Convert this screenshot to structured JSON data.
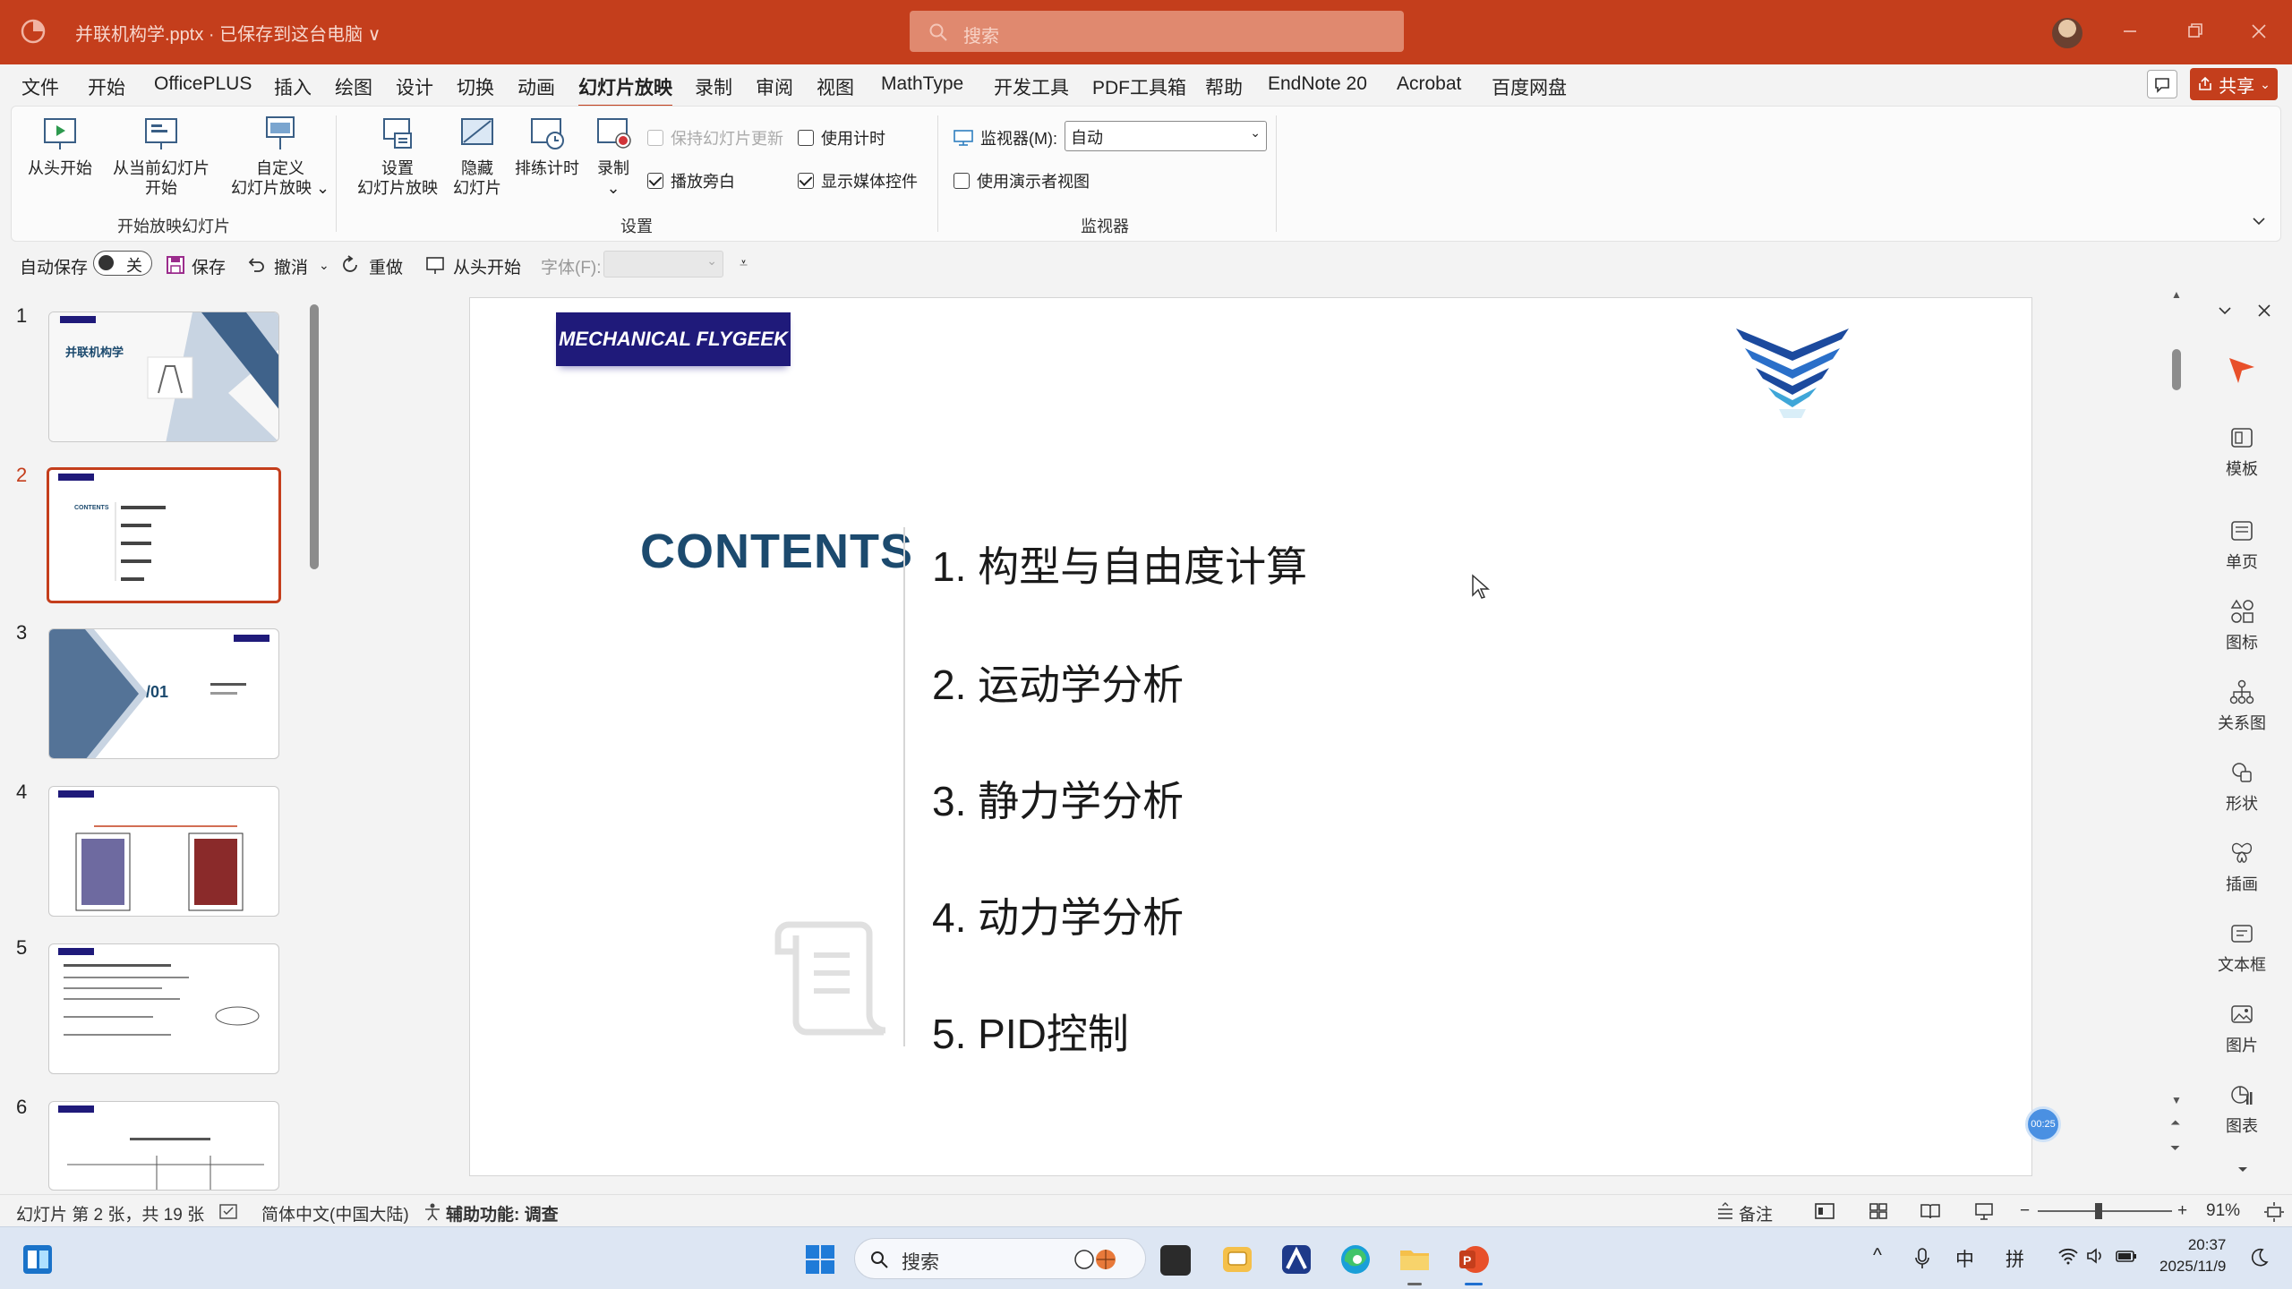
{
  "titlebar": {
    "document_title": "并联机构学.pptx · 已保存到这台电脑 ∨",
    "search_placeholder": "搜索",
    "accent_color": "#c43e1c"
  },
  "menu": {
    "items": [
      "文件",
      "开始",
      "OfficePLUS",
      "插入",
      "绘图",
      "设计",
      "切换",
      "动画",
      "幻灯片放映",
      "录制",
      "审阅",
      "视图",
      "MathType",
      "开发工具",
      "PDF工具箱",
      "帮助",
      "EndNote 20",
      "Acrobat",
      "百度网盘"
    ],
    "active": "幻灯片放映",
    "share_label": "共享"
  },
  "ribbon": {
    "start_group": {
      "from_beginning": "从头开始",
      "from_current_1": "从当前幻灯片",
      "from_current_2": "开始",
      "custom_1": "自定义",
      "custom_2": "幻灯片放映",
      "label": "开始放映幻灯片"
    },
    "setup_group": {
      "setup_1": "设置",
      "setup_2": "幻灯片放映",
      "hide_1": "隐藏",
      "hide_2": "幻灯片",
      "rehearse": "排练计时",
      "record": "录制",
      "keep_updated": "保持幻灯片更新",
      "play_narration": "播放旁白",
      "use_timings": "使用计时",
      "show_media": "显示媒体控件",
      "label": "设置"
    },
    "monitor_group": {
      "monitor_label": "监视器(M):",
      "monitor_value": "自动",
      "presenter_view": "使用演示者视图",
      "label": "监视器"
    }
  },
  "qat": {
    "autosave": "自动保存",
    "autosave_state": "关",
    "save": "保存",
    "undo": "撤消",
    "redo": "重做",
    "from_beginning": "从头开始",
    "font_label": "字体(F):"
  },
  "thumbnails": {
    "numbers": [
      "1",
      "2",
      "3",
      "4",
      "5",
      "6"
    ],
    "selected": "2",
    "slide1_title": "并联机构学",
    "slide3_num": "/01"
  },
  "slide": {
    "logo_text": "MECHANICAL FLYGEEK",
    "contents_title": "CONTENTS",
    "items": [
      "1. 构型与自由度计算",
      "2. 运动学分析",
      "3. 静力学分析",
      "4. 动力学分析",
      "5. PID控制"
    ],
    "timer_badge": "00:25",
    "title_color": "#1c4a6e",
    "logo_color": "#1f1a7a"
  },
  "right_pane": {
    "items": [
      "模板",
      "单页",
      "图标",
      "关系图",
      "形状",
      "插画",
      "文本框",
      "图片",
      "图表"
    ]
  },
  "statusbar": {
    "slide_info": "幻灯片 第 2 张，共 19 张",
    "language": "简体中文(中国大陆)",
    "accessibility": "辅助功能: 调查",
    "notes": "备注",
    "zoom": "91%"
  },
  "taskbar": {
    "search_label": "搜索",
    "ime_1": "中",
    "ime_2": "拼",
    "time": "20:37",
    "date": "2025/11/9"
  }
}
